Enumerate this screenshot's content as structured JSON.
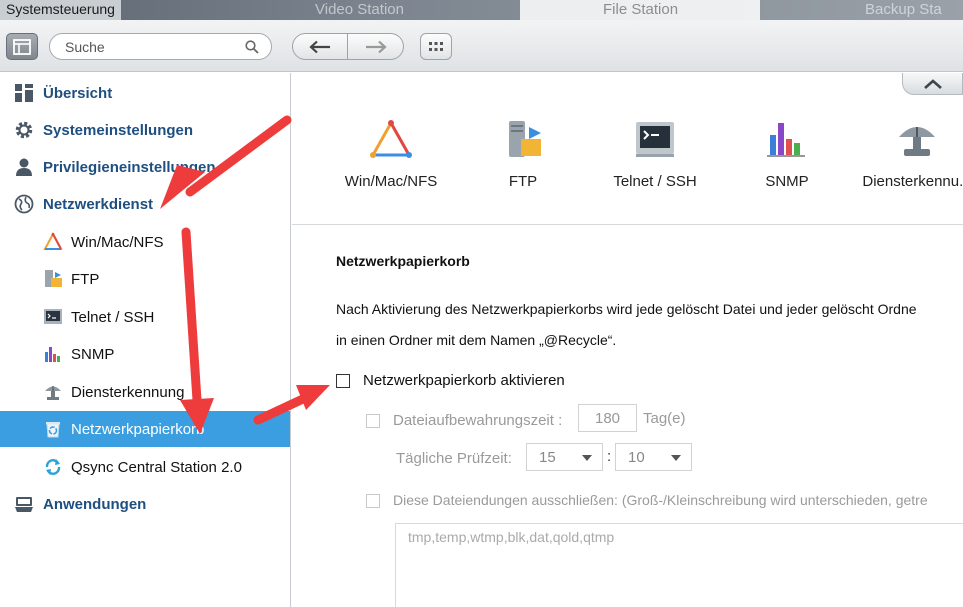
{
  "titlebar": {
    "active_title": "Systemsteuerung",
    "tabs": [
      "Systemsteuerung",
      "Video Station",
      "File Station",
      "Backup Sta"
    ]
  },
  "toolbar": {
    "search_placeholder": "Suche"
  },
  "sidebar": {
    "items": [
      {
        "label": "Übersicht",
        "icon": "overview-grid-icon",
        "level": 0
      },
      {
        "label": "Systemeinstellungen",
        "icon": "gear-icon",
        "level": 0
      },
      {
        "label": "Privilegieneinstellungen",
        "icon": "user-icon",
        "level": 0
      },
      {
        "label": "Netzwerkdienst",
        "icon": "globe-icon",
        "level": 0
      },
      {
        "label": "Win/Mac/NFS",
        "icon": "triangle-network-icon",
        "level": 1
      },
      {
        "label": "FTP",
        "icon": "ftp-server-icon",
        "level": 1
      },
      {
        "label": "Telnet / SSH",
        "icon": "terminal-icon",
        "level": 1
      },
      {
        "label": "SNMP",
        "icon": "bar-chart-icon",
        "level": 1
      },
      {
        "label": "Diensterkennung",
        "icon": "satellite-dish-icon",
        "level": 1
      },
      {
        "label": "Netzwerkpapierkorb",
        "icon": "recycle-bin-icon",
        "level": 1,
        "selected": true
      },
      {
        "label": "Qsync Central Station 2.0",
        "icon": "sync-icon",
        "level": 1
      },
      {
        "label": "Anwendungen",
        "icon": "applications-icon",
        "level": 0
      }
    ]
  },
  "services": [
    {
      "label": "Win/Mac/NFS",
      "icon": "triangle-network-icon"
    },
    {
      "label": "FTP",
      "icon": "ftp-server-icon"
    },
    {
      "label": "Telnet / SSH",
      "icon": "terminal-icon"
    },
    {
      "label": "SNMP",
      "icon": "bar-chart-icon"
    },
    {
      "label": "Diensterkennu...",
      "icon": "satellite-dish-icon"
    }
  ],
  "panel": {
    "title": "Netzwerkpapierkorb",
    "desc_line1": "Nach Aktivierung des Netzwerkpapierkorbs wird jede gelöscht Datei und jeder gelöscht Ordne",
    "desc_line2": "in einen Ordner mit dem Namen „@Recycle“.",
    "enable_label": "Netzwerkpapierkorb aktivieren",
    "retention_label": "Dateiaufbewahrungszeit :",
    "retention_value": "180",
    "retention_unit": "Tag(e)",
    "check_time_label": "Tägliche Prüfzeit:",
    "check_hour": "15",
    "time_separator": ":",
    "check_minute": "10",
    "exclude_label": "Diese Dateiendungen ausschließen: (Groß-/Kleinschreibung wird unterschieden, getre",
    "exclude_value": "tmp,temp,wtmp,blk,dat,qold,qtmp"
  },
  "colors": {
    "accent": "#3a9ee0",
    "nav_text": "#1f4f80",
    "annotation_arrow": "#ee3c3c"
  }
}
